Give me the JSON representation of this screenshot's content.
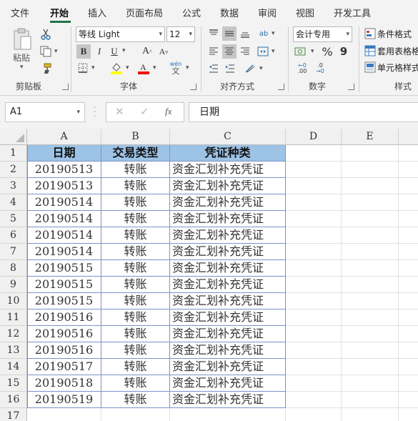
{
  "ribbon": {
    "tabs": [
      "文件",
      "开始",
      "插入",
      "页面布局",
      "公式",
      "数据",
      "审阅",
      "视图",
      "开发工具"
    ],
    "active_tab": "开始",
    "clipboard": {
      "paste_label": "粘贴",
      "group_label": "剪贴板"
    },
    "font": {
      "name": "等线 Light",
      "size": "12",
      "group_label": "字体",
      "bold": "B",
      "italic": "I",
      "underline": "U",
      "grow": "A",
      "shrink": "A",
      "phonetic": "wén"
    },
    "alignment": {
      "group_label": "对齐方式"
    },
    "number": {
      "format": "会计专用",
      "group_label": "数字",
      "percent": "%",
      "comma": "9",
      "inc_decimal": ".00",
      "dec_decimal": ".0"
    },
    "styles": {
      "group_label": "样式",
      "conditional": "条件格式",
      "table_format": "套用表格格",
      "cell_styles": "单元格样式"
    }
  },
  "formula_bar": {
    "name_box": "A1",
    "content": "日期"
  },
  "grid": {
    "columns": [
      "A",
      "B",
      "C",
      "D",
      "E"
    ],
    "rows": [
      "1",
      "2",
      "3",
      "4",
      "5",
      "6",
      "7",
      "8",
      "9",
      "10",
      "11",
      "12",
      "13",
      "14",
      "15",
      "16",
      "17"
    ],
    "header": [
      "日期",
      "交易类型",
      "凭证种类"
    ],
    "data": [
      [
        "20190513",
        "转账",
        "资金汇划补充凭证"
      ],
      [
        "20190513",
        "转账",
        "资金汇划补充凭证"
      ],
      [
        "20190514",
        "转账",
        "资金汇划补充凭证"
      ],
      [
        "20190514",
        "转账",
        "资金汇划补充凭证"
      ],
      [
        "20190514",
        "转账",
        "资金汇划补充凭证"
      ],
      [
        "20190514",
        "转账",
        "资金汇划补充凭证"
      ],
      [
        "20190515",
        "转账",
        "资金汇划补充凭证"
      ],
      [
        "20190515",
        "转账",
        "资金汇划补充凭证"
      ],
      [
        "20190515",
        "转账",
        "资金汇划补充凭证"
      ],
      [
        "20190516",
        "转账",
        "资金汇划补充凭证"
      ],
      [
        "20190516",
        "转账",
        "资金汇划补充凭证"
      ],
      [
        "20190516",
        "转账",
        "资金汇划补充凭证"
      ],
      [
        "20190517",
        "转账",
        "资金汇划补充凭证"
      ],
      [
        "20190518",
        "转账",
        "资金汇划补充凭证"
      ],
      [
        "20190519",
        "转账",
        "资金汇划补充凭证"
      ]
    ],
    "header_fill": "#9dc3e6",
    "table_border": "#7b93c9"
  },
  "colors": {
    "accent": "#217346",
    "highlight": "#ffff00",
    "font_color": "#ff0000"
  }
}
